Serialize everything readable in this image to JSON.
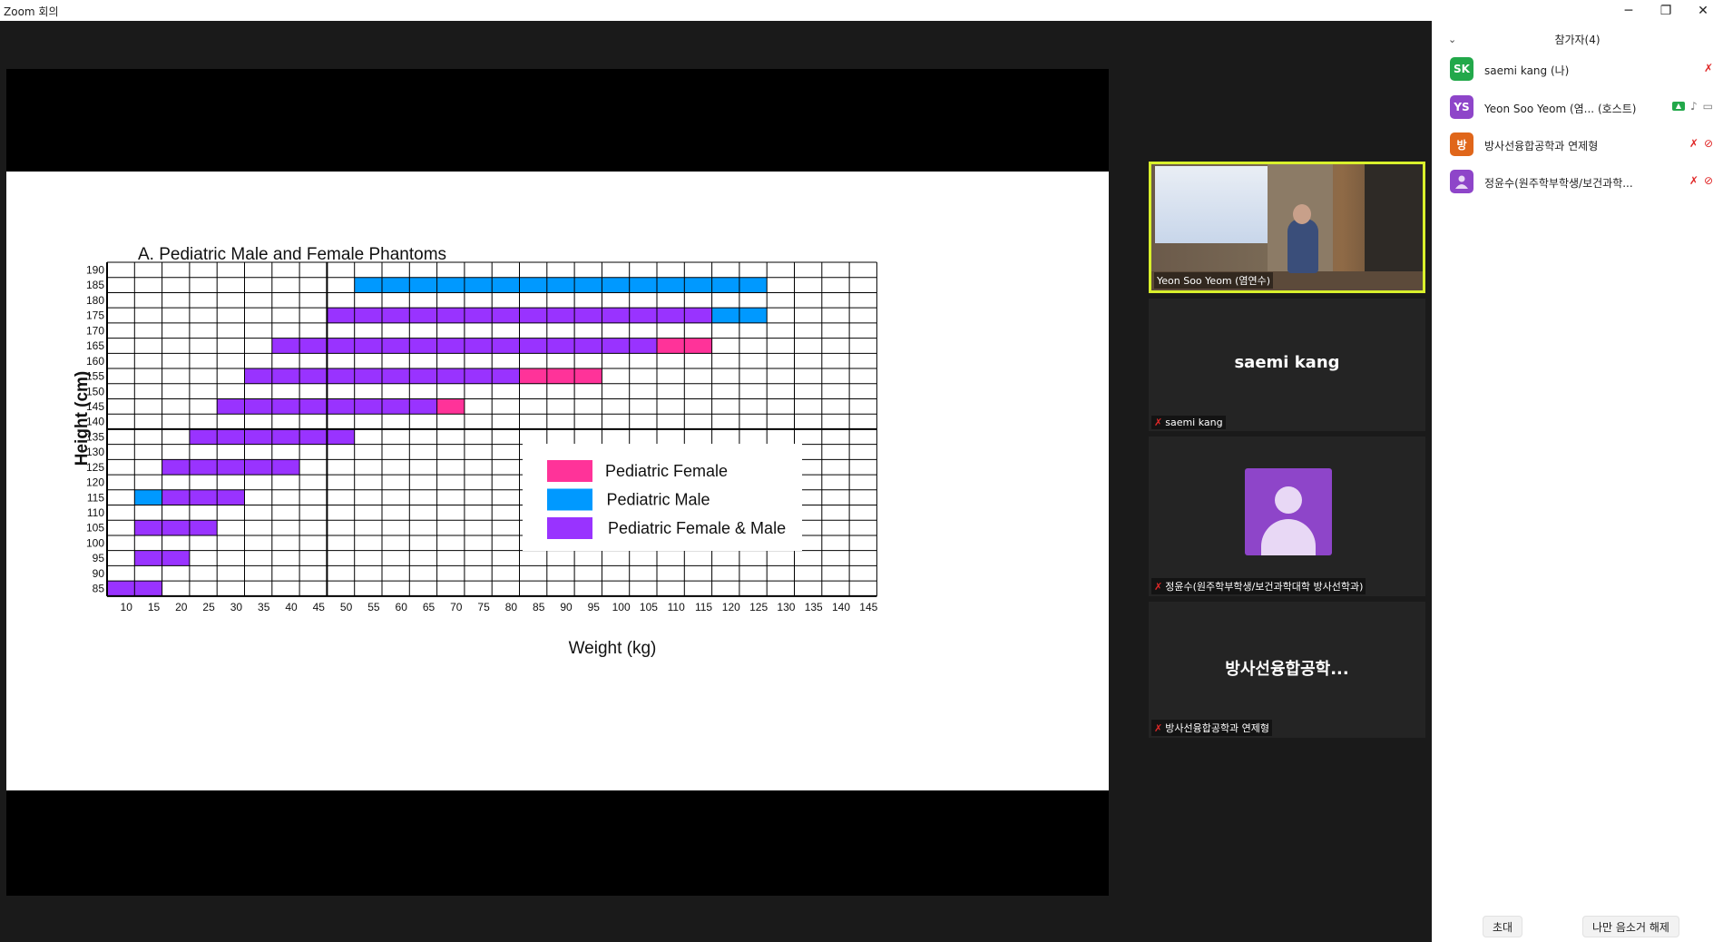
{
  "window": {
    "title": "Zoom 회의",
    "minimize": "─",
    "restore": "❐",
    "close": "✕"
  },
  "slide": {
    "chart_data": {
      "type": "heatmap",
      "title": "A. Pediatric Male and Female Phantoms",
      "xlabel": "Weight (kg)",
      "ylabel": "Height (cm)",
      "x_ticks": [
        10,
        15,
        20,
        25,
        30,
        35,
        40,
        45,
        50,
        55,
        60,
        65,
        70,
        75,
        80,
        85,
        90,
        95,
        100,
        105,
        110,
        115,
        120,
        125,
        130,
        135,
        140,
        145
      ],
      "y_ticks": [
        190,
        185,
        180,
        175,
        170,
        165,
        160,
        155,
        150,
        145,
        140,
        135,
        130,
        125,
        120,
        115,
        110,
        105,
        100,
        95,
        90,
        85
      ],
      "legend": [
        {
          "label": "Pediatric Female",
          "color": "#ff3399"
        },
        {
          "label": "Pediatric Male",
          "color": "#0099ff"
        },
        {
          "label": "Pediatric Female & Male",
          "color": "#9933ff"
        }
      ],
      "cells": [
        {
          "height": 185,
          "weight_from": 55,
          "weight_to": 125,
          "category": "Pediatric Male"
        },
        {
          "height": 175,
          "weight_from": 50,
          "weight_to": 115,
          "category": "Pediatric Female & Male"
        },
        {
          "height": 175,
          "weight_from": 120,
          "weight_to": 125,
          "category": "Pediatric Male"
        },
        {
          "height": 165,
          "weight_from": 40,
          "weight_to": 105,
          "category": "Pediatric Female & Male"
        },
        {
          "height": 165,
          "weight_from": 110,
          "weight_to": 115,
          "category": "Pediatric Female"
        },
        {
          "height": 155,
          "weight_from": 35,
          "weight_to": 80,
          "category": "Pediatric Female & Male"
        },
        {
          "height": 155,
          "weight_from": 85,
          "weight_to": 95,
          "category": "Pediatric Female"
        },
        {
          "height": 145,
          "weight_from": 30,
          "weight_to": 65,
          "category": "Pediatric Female & Male"
        },
        {
          "height": 145,
          "weight_from": 70,
          "weight_to": 70,
          "category": "Pediatric Female"
        },
        {
          "height": 135,
          "weight_from": 25,
          "weight_to": 50,
          "category": "Pediatric Female & Male"
        },
        {
          "height": 125,
          "weight_from": 20,
          "weight_to": 40,
          "category": "Pediatric Female & Male"
        },
        {
          "height": 115,
          "weight_from": 15,
          "weight_to": 15,
          "category": "Pediatric Male"
        },
        {
          "height": 115,
          "weight_from": 20,
          "weight_to": 30,
          "category": "Pediatric Female & Male"
        },
        {
          "height": 105,
          "weight_from": 15,
          "weight_to": 25,
          "category": "Pediatric Female & Male"
        },
        {
          "height": 95,
          "weight_from": 15,
          "weight_to": 20,
          "category": "Pediatric Female & Male"
        },
        {
          "height": 85,
          "weight_from": 10,
          "weight_to": 15,
          "category": "Pediatric Female & Male"
        }
      ]
    }
  },
  "tiles": {
    "host_label": "Yeon Soo Yeom (염연수)",
    "t2_center": "saemi kang",
    "t2_label": "saemi kang",
    "t3_label": "정윤수(원주학부학생/보건과학대학 방사선학과)",
    "t4_center": "방사선융합공학...",
    "t4_label": "방사선융합공학과 연제형",
    "mute_glyph": "🎙"
  },
  "panel": {
    "title": "참가자(4)",
    "collapse_glyph": "⌄",
    "participants": [
      {
        "initials": "SK",
        "name": "saemi kang (나)",
        "color": "#22a84a"
      },
      {
        "initials": "YS",
        "name": "Yeon Soo Yeom (염...  (호스트)",
        "color": "#8e45c9"
      },
      {
        "initials": "방",
        "name": "방사선융합공학과 연제형",
        "color": "#e0661a"
      },
      {
        "initials": "",
        "name": "정윤수(원주학부학생/보건과학...",
        "color": "#8e45c9"
      }
    ],
    "invite": "초대",
    "unmute_me": "나만 음소거 해제"
  }
}
